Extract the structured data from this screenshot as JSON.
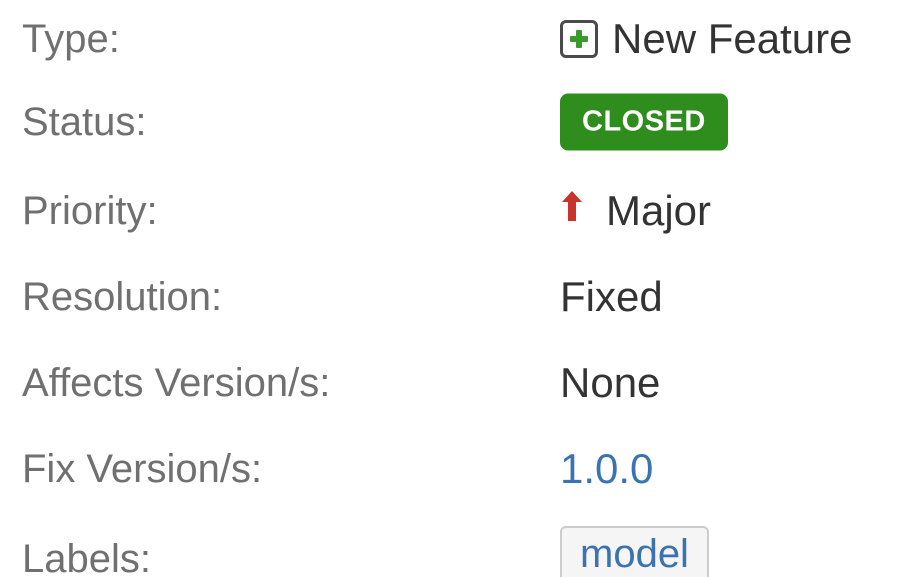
{
  "fields": {
    "type": {
      "label": "Type:",
      "value": "New Feature",
      "icon": "new-feature-icon",
      "icon_color": "#3b9a2c"
    },
    "status": {
      "label": "Status:",
      "value": "CLOSED",
      "color": "#2f8d1e"
    },
    "priority": {
      "label": "Priority:",
      "value": "Major",
      "icon": "arrow-up-icon",
      "icon_color": "#c8332b"
    },
    "resolution": {
      "label": "Resolution:",
      "value": "Fixed"
    },
    "affects_versions": {
      "label": "Affects Version/s:",
      "value": "None"
    },
    "fix_versions": {
      "label": "Fix Version/s:",
      "value": "1.0.0",
      "link_color": "#3b73af"
    },
    "labels": {
      "label": "Labels:",
      "values": [
        "model"
      ]
    }
  }
}
